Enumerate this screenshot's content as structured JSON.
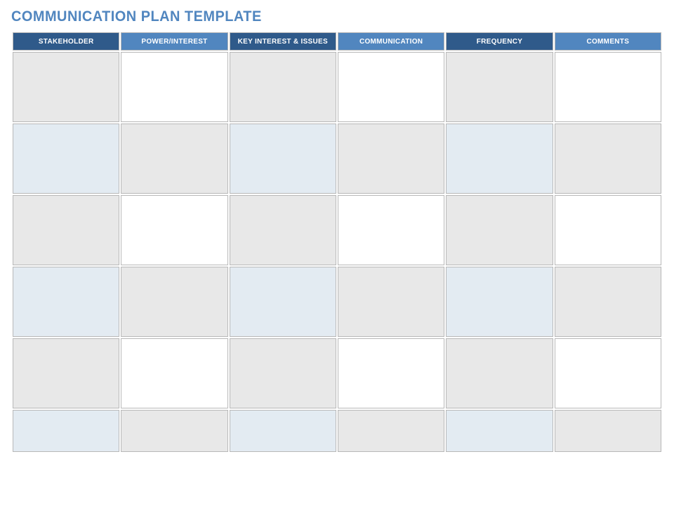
{
  "title": "COMMUNICATION PLAN TEMPLATE",
  "columns": [
    {
      "label": "STAKEHOLDER",
      "dark": true
    },
    {
      "label": "POWER/INTEREST",
      "dark": false
    },
    {
      "label": "KEY INTEREST & ISSUES",
      "dark": true
    },
    {
      "label": "COMMUNICATION",
      "dark": false
    },
    {
      "label": "FREQUENCY",
      "dark": true
    },
    {
      "label": "COMMENTS",
      "dark": false
    }
  ],
  "rows": [
    {
      "style": "normal",
      "cells": [
        "",
        "",
        "",
        "",
        "",
        ""
      ]
    },
    {
      "style": "alt",
      "cells": [
        "",
        "",
        "",
        "",
        "",
        ""
      ]
    },
    {
      "style": "normal",
      "cells": [
        "",
        "",
        "",
        "",
        "",
        ""
      ]
    },
    {
      "style": "alt",
      "cells": [
        "",
        "",
        "",
        "",
        "",
        ""
      ]
    },
    {
      "style": "normal",
      "cells": [
        "",
        "",
        "",
        "",
        "",
        ""
      ]
    },
    {
      "style": "alt",
      "cells": [
        "",
        "",
        "",
        "",
        "",
        ""
      ]
    }
  ]
}
